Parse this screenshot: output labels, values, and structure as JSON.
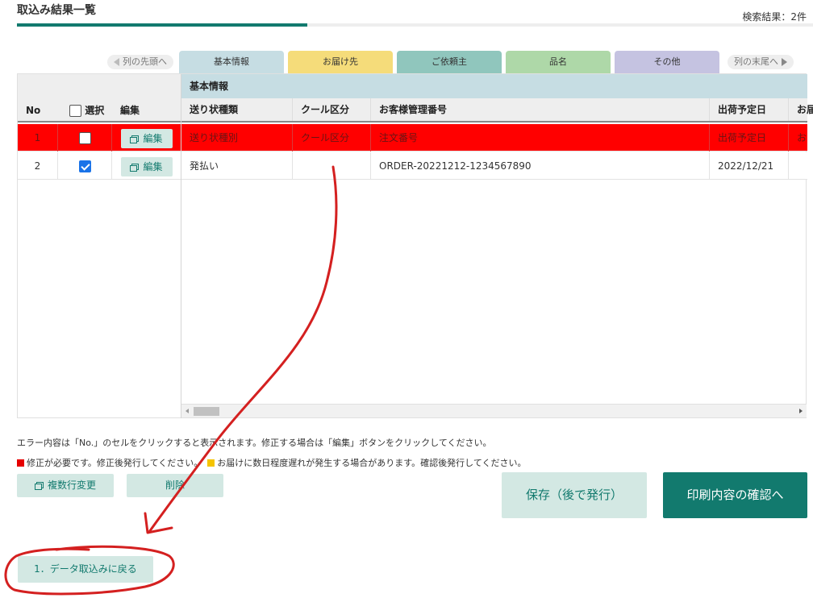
{
  "header": {
    "title": "取込み結果一覧",
    "result_count": "検索結果：2件"
  },
  "tabs": {
    "prev_label": "列の先頭へ",
    "next_label": "列の末尾へ",
    "items": [
      {
        "label": "基本情報",
        "color": "#c6dde3"
      },
      {
        "label": "お届け先",
        "color": "#f5dc7a"
      },
      {
        "label": "ご依頼主",
        "color": "#90c6bd"
      },
      {
        "label": "品名",
        "color": "#aed8a8"
      },
      {
        "label": "その他",
        "color": "#c5c3e1"
      }
    ]
  },
  "grid": {
    "group_label": "基本情報",
    "fixed_headers": {
      "no": "No",
      "select": "選択",
      "edit": "編集"
    },
    "columns": [
      "送り状種類",
      "クール区分",
      "お客様管理番号",
      "出荷予定日",
      "お届"
    ],
    "edit_button_label": "編集",
    "rows": [
      {
        "no": "1",
        "checked": false,
        "error": true,
        "cells": [
          "送り状種別",
          "クール区分",
          "注文番号",
          "出荷予定日",
          "お"
        ]
      },
      {
        "no": "2",
        "checked": true,
        "error": false,
        "cells": [
          "発払い",
          "",
          "ORDER-20221212-1234567890",
          "2022/12/21",
          ""
        ]
      }
    ]
  },
  "notes": {
    "line1": "エラー内容は「No.」のセルをクリックすると表示されます。修正する場合は「編集」ボタンをクリックしてください。",
    "legend_red": "修正が必要です。修正後発行してください。",
    "legend_yellow": "お届けに数日程度遅れが発生する場合があります。確認後発行してください。"
  },
  "buttons": {
    "multi_edit": "複数行変更",
    "delete": "削除",
    "save": "保存（後で発行）",
    "print_confirm": "印刷内容の確認へ",
    "back": "1．データ取込みに戻る"
  },
  "colors": {
    "accent": "#127a6e",
    "error_row": "#ff0000",
    "annotation": "#d42020"
  }
}
